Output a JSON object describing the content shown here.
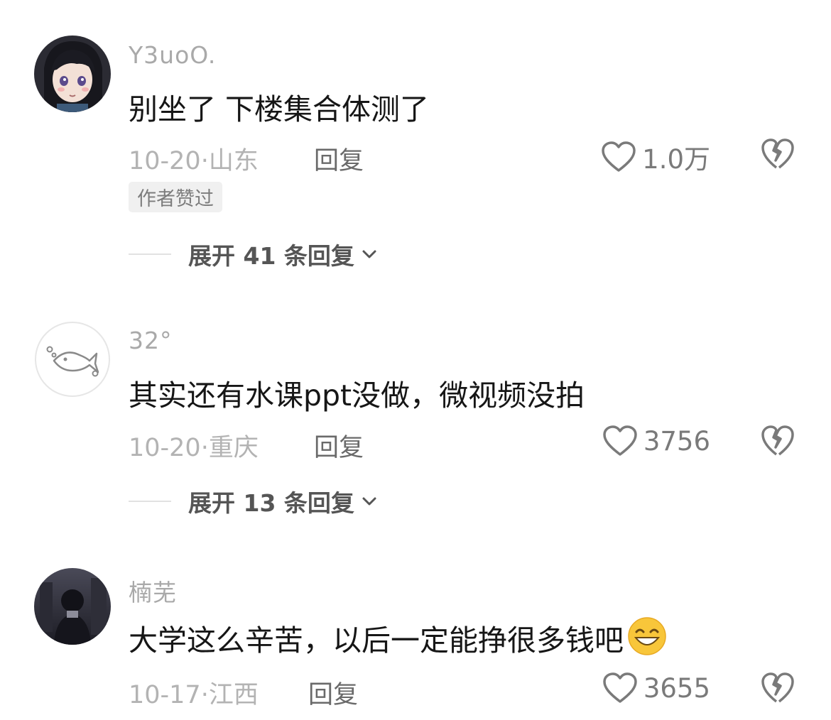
{
  "comments": [
    {
      "username": "Y3uoO.",
      "text": "别坐了 下楼集合体测了",
      "date": "10-20",
      "sep": "·",
      "location": "山东",
      "reply_label": "回复",
      "likes": "1.0万",
      "badge": "作者赞过",
      "expand_label": "展开 41 条回复"
    },
    {
      "username": "32°",
      "text": "其实还有水课ppt没做，微视频没拍",
      "date": "10-20",
      "sep": "·",
      "location": "重庆",
      "reply_label": "回复",
      "likes": "3756",
      "expand_label": "展开 13 条回复"
    },
    {
      "username": "楠芜",
      "text": "大学这么辛苦，以后一定能挣很多钱吧",
      "emoji": "grinning-face-emoji",
      "date": "10-17",
      "sep": "·",
      "location": "江西",
      "reply_label": "回复",
      "likes": "3655"
    }
  ],
  "colors": {
    "username": "#a9a9a9",
    "text": "#161616",
    "meta": "#b3b3b3",
    "icon": "#7a7a7a",
    "badge_bg": "#f0f0f0"
  }
}
